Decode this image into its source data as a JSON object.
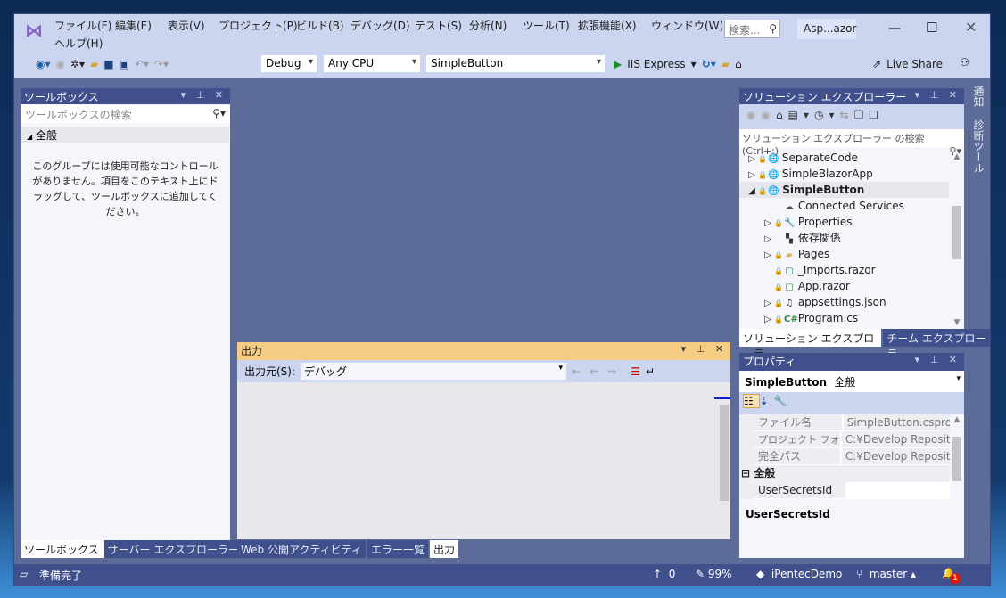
{
  "menu": [
    "ファイル(F)",
    "編集(E)",
    "表示(V)",
    "プロジェクト(P)",
    "ビルド(B)",
    "デバッグ(D)",
    "テスト(S)",
    "分析(N)",
    "ツール(T)",
    "拡張機能(X)",
    "ウィンドウ(W)",
    "ヘルプ(H)"
  ],
  "search_placeholder": "検索...",
  "solution_title": "Asp...azor",
  "toolbar": {
    "config": "Debug",
    "platform": "Any CPU",
    "startup": "SimpleButton",
    "run": "IIS Express",
    "live_share": "Live Share"
  },
  "toolbox": {
    "title": "ツールボックス",
    "search_placeholder": "ツールボックスの検索",
    "group": "全般",
    "empty": "このグループには使用可能なコントロールがありません。項目をこのテキスト上にドラッグして、ツールボックスに追加してください。",
    "tabs": [
      "ツールボックス",
      "サーバー エクスプローラー"
    ]
  },
  "output": {
    "title": "出力",
    "source_label": "出力元(S):",
    "source": "デバッグ",
    "tabs": [
      "Web 公開アクティビティ",
      "エラー一覧",
      "出力"
    ]
  },
  "solution_explorer": {
    "title": "ソリューション エクスプローラー",
    "search_placeholder": "ソリューション エクスプローラー の検索 (Ctrl+:)",
    "items": [
      {
        "label": "SeparateCode",
        "icon": "web-project-icon"
      },
      {
        "label": "SimpleBlazorApp",
        "icon": "web-project-icon"
      },
      {
        "label": "SimpleButton",
        "icon": "web-project-icon"
      },
      {
        "label": "Connected Services",
        "icon": "cloud-icon"
      },
      {
        "label": "Properties",
        "icon": "wrench-icon"
      },
      {
        "label": "依存関係",
        "icon": "dependencies-icon"
      },
      {
        "label": "Pages",
        "icon": "folder-icon"
      },
      {
        "label": "_Imports.razor",
        "icon": "razor-file-icon"
      },
      {
        "label": "App.razor",
        "icon": "razor-file-icon"
      },
      {
        "label": "appsettings.json",
        "icon": "json-file-icon"
      },
      {
        "label": "Program.cs",
        "icon": "csharp-file-icon"
      }
    ],
    "tabs": [
      "ソリューション エクスプローラー",
      "チーム エクスプローラー"
    ]
  },
  "side_tabs": [
    "通知",
    "診断ツール"
  ],
  "properties": {
    "title": "プロパティ",
    "object": "SimpleButton",
    "object_kind": "全般",
    "rows": [
      {
        "k": "ファイル名",
        "v": "SimpleButton.csproj"
      },
      {
        "k": "プロジェクト フォルダー",
        "v": "C:¥Develop Reposito"
      },
      {
        "k": "完全パス",
        "v": "C:¥Develop Reposito"
      }
    ],
    "category": "全般",
    "prop": "UserSecretsId",
    "prop_value": "",
    "description": "UserSecretsId"
  },
  "status": {
    "ready": "準備完了",
    "up": "0",
    "edit": "99%",
    "repo": "iPentecDemo",
    "branch": "master",
    "notifications": "1"
  },
  "colors": {
    "accent": "#40508d",
    "output_header": "#f5cc84",
    "chrome": "#ccd5f0"
  }
}
